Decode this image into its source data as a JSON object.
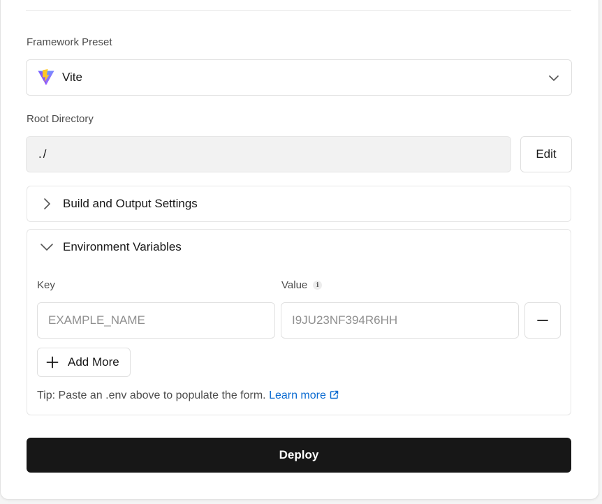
{
  "framework": {
    "label": "Framework Preset",
    "selected": "Vite",
    "icon": "vite-logo"
  },
  "root_directory": {
    "label": "Root Directory",
    "value": "./",
    "edit_label": "Edit"
  },
  "build_settings": {
    "title": "Build and Output Settings",
    "expanded": false
  },
  "env_vars": {
    "title": "Environment Variables",
    "expanded": true,
    "key_label": "Key",
    "value_label": "Value",
    "key_placeholder": "EXAMPLE_NAME",
    "value_placeholder": "I9JU23NF394R6HH",
    "add_more_label": "Add More",
    "tip_text": "Tip: Paste an .env above to populate the form.",
    "learn_more_label": "Learn more"
  },
  "deploy": {
    "label": "Deploy"
  },
  "colors": {
    "primary": "#171717",
    "link": "#0b6bd1",
    "vite_purple": "#8a52ff",
    "vite_yellow": "#ffc825"
  }
}
